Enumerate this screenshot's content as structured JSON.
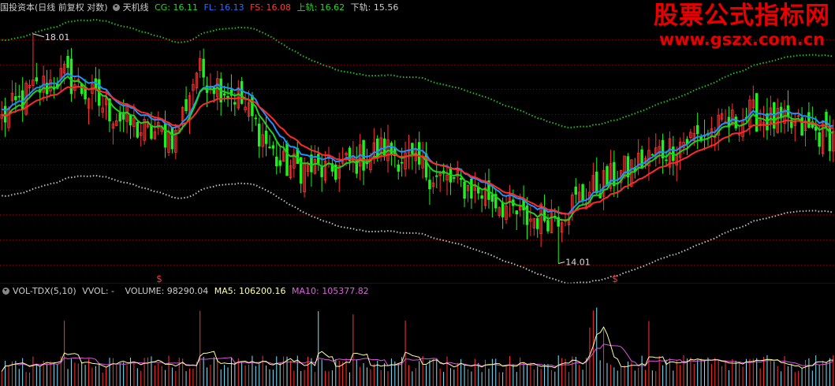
{
  "price_panel": {
    "instrument": "国投资本(日线 前复权 对数)",
    "indicator_name": "天机线",
    "cg_label": "CG: 16.11",
    "fl_label": "FL: 16.13",
    "fs_label": "FS: 16.08",
    "upper_label": "上轨: 16.62",
    "lower_label": "下轨: 15.56",
    "high_marker": "18.01",
    "low_marker": "14.01",
    "signal_glyph": "$"
  },
  "volume_panel": {
    "indicator_name": "VOL-TDX(5,10)",
    "vvol_label": "VVOL: -",
    "volume_label": "VOLUME: 98290.04",
    "ma5_label": "MA5: 106200.16",
    "ma10_label": "MA10: 105377.82"
  },
  "watermark": {
    "line1": "股票公式指标网",
    "line2": "www.gszx.com.cn"
  },
  "colors": {
    "background": "#000000",
    "up": "#ff3232",
    "down": "#1ef21e",
    "fs_line": "#ff2a2a",
    "cg_line": "#1e90ff",
    "fl_line": "#20d020",
    "upper_band": "#22bb22",
    "lower_band": "#bbbbbb",
    "ma5": "#ffffa0",
    "ma10": "#e050e0",
    "volume_up": "#ff3232",
    "volume_down": "#7fe5ff",
    "grid": "#7a0000"
  },
  "chart_data": [
    {
      "type": "candlestick",
      "title": "天机线",
      "scale": "log",
      "ylim": [
        13.8,
        18.4
      ],
      "grid": true,
      "num_bars": 240,
      "extremes": {
        "high": 18.01,
        "low": 14.01
      },
      "key_closes": [
        {
          "bar": 0,
          "close": 16.4
        },
        {
          "bar": 8,
          "close": 16.9
        },
        {
          "bar": 18,
          "close": 17.2
        },
        {
          "bar": 30,
          "close": 16.6
        },
        {
          "bar": 40,
          "close": 16.2
        },
        {
          "bar": 50,
          "close": 16.1
        },
        {
          "bar": 56,
          "close": 17.3
        },
        {
          "bar": 68,
          "close": 16.8
        },
        {
          "bar": 80,
          "close": 15.6
        },
        {
          "bar": 95,
          "close": 15.5
        },
        {
          "bar": 110,
          "close": 15.9
        },
        {
          "bar": 125,
          "close": 15.4
        },
        {
          "bar": 140,
          "close": 15.1
        },
        {
          "bar": 150,
          "close": 14.7
        },
        {
          "bar": 160,
          "close": 14.8
        },
        {
          "bar": 170,
          "close": 15.2
        },
        {
          "bar": 185,
          "close": 15.7
        },
        {
          "bar": 195,
          "close": 16.0
        },
        {
          "bar": 205,
          "close": 16.2
        },
        {
          "bar": 215,
          "close": 16.5
        },
        {
          "bar": 225,
          "close": 16.3
        },
        {
          "bar": 239,
          "close": 16.1
        }
      ],
      "series": [
        {
          "name": "CG",
          "last": 16.11
        },
        {
          "name": "FL",
          "last": 16.13
        },
        {
          "name": "FS",
          "last": 16.08
        },
        {
          "name": "上轨",
          "last": 16.62
        },
        {
          "name": "下轨",
          "last": 15.56
        }
      ]
    },
    {
      "type": "bar",
      "title": "VOL-TDX(5,10)",
      "num_bars": 240,
      "series": [
        {
          "name": "VOLUME",
          "last": 98290.04
        },
        {
          "name": "MA5",
          "last": 106200.16
        },
        {
          "name": "MA10",
          "last": 105377.82
        }
      ]
    }
  ]
}
